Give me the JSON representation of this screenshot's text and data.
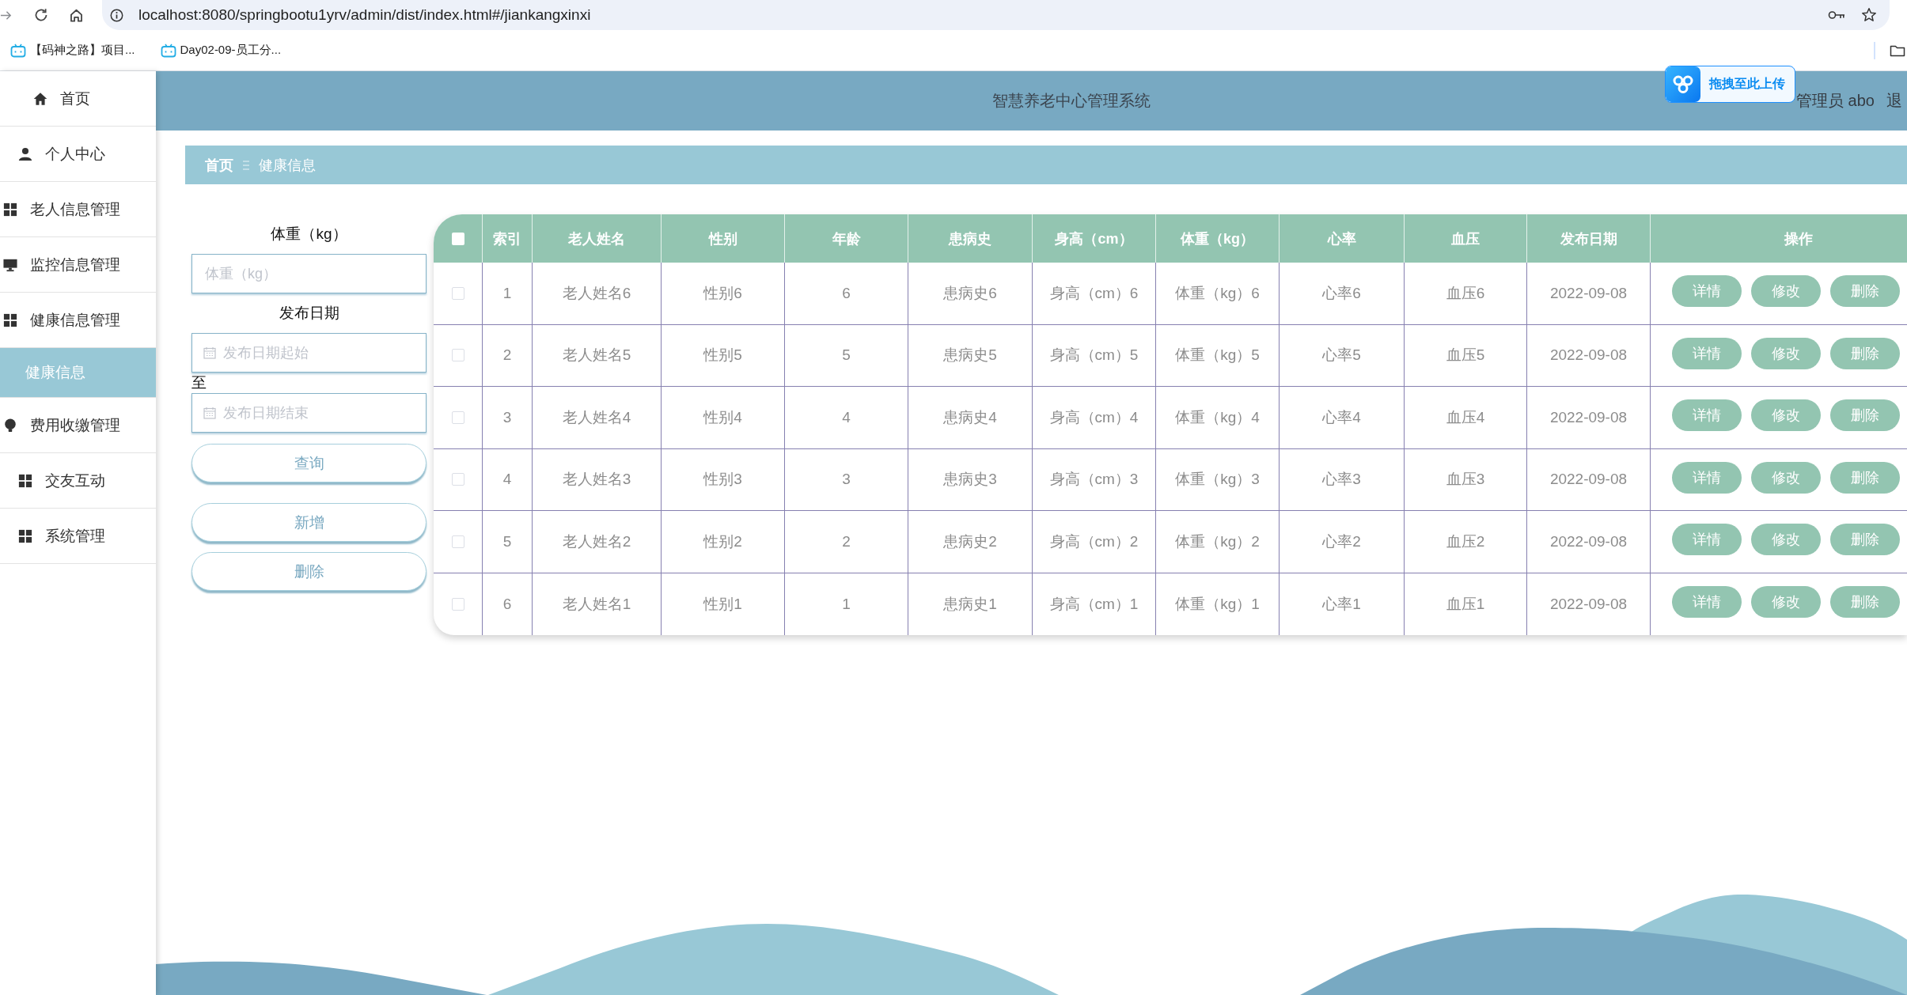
{
  "browser": {
    "url": "localhost:8080/springbootu1yrv/admin/dist/index.html#/jiankangxinxi",
    "bookmarks": [
      {
        "label": "【码神之路】项目..."
      },
      {
        "label": "Day02-09-员工分..."
      }
    ]
  },
  "upload_widget": {
    "label": "拖拽至此上传"
  },
  "sidebar": {
    "items": [
      {
        "label": "首页",
        "kind": "home",
        "selected": false
      },
      {
        "label": "个人中心",
        "kind": "person",
        "selected": false
      },
      {
        "label": "老人信息管理",
        "kind": "grid",
        "selected": false
      },
      {
        "label": "监控信息管理",
        "kind": "monitor",
        "selected": false
      },
      {
        "label": "健康信息管理",
        "kind": "grid",
        "selected": false,
        "expanded": true,
        "children": [
          {
            "label": "健康信息",
            "selected": true
          }
        ]
      },
      {
        "label": "费用收缴管理",
        "kind": "bulb",
        "selected": false
      },
      {
        "label": "交友互动",
        "kind": "grid",
        "selected": false
      },
      {
        "label": "系统管理",
        "kind": "grid",
        "selected": false
      }
    ]
  },
  "header": {
    "title": "智慧养老中心管理系统",
    "user": "管理员 abo",
    "logout": "退"
  },
  "breadcrumb": [
    {
      "label": "首页",
      "kind": "link"
    },
    {
      "label": "健康信息",
      "kind": "current"
    }
  ],
  "search": {
    "weight": {
      "label": "体重（kg）",
      "placeholder": "体重（kg）"
    },
    "date": {
      "label": "发布日期",
      "start": {
        "placeholder": "发布日期起始"
      },
      "separator": "至",
      "end": {
        "placeholder": "发布日期结束"
      }
    },
    "buttons": [
      "查询",
      "新增",
      "删除"
    ]
  },
  "table": {
    "select_all": {
      "checked": false
    },
    "columns": [
      "索引",
      "老人姓名",
      "性别",
      "年龄",
      "患病史",
      "身高（cm）",
      "体重（kg）",
      "心率",
      "血压",
      "发布日期",
      "操作"
    ],
    "rows": [
      {
        "checked": false,
        "cells": [
          "1",
          "老人姓名6",
          "性别6",
          "6",
          "患病史6",
          "身高（cm）6",
          "体重（kg）6",
          "心率6",
          "血压6",
          "2022-09-08"
        ],
        "actions": [
          "详情",
          "修改",
          "删除"
        ]
      },
      {
        "checked": false,
        "cells": [
          "2",
          "老人姓名5",
          "性别5",
          "5",
          "患病史5",
          "身高（cm）5",
          "体重（kg）5",
          "心率5",
          "血压5",
          "2022-09-08"
        ],
        "actions": [
          "详情",
          "修改",
          "删除"
        ]
      },
      {
        "checked": false,
        "cells": [
          "3",
          "老人姓名4",
          "性别4",
          "4",
          "患病史4",
          "身高（cm）4",
          "体重（kg）4",
          "心率4",
          "血压4",
          "2022-09-08"
        ],
        "actions": [
          "详情",
          "修改",
          "删除"
        ]
      },
      {
        "checked": false,
        "cells": [
          "4",
          "老人姓名3",
          "性别3",
          "3",
          "患病史3",
          "身高（cm）3",
          "体重（kg）3",
          "心率3",
          "血压3",
          "2022-09-08"
        ],
        "actions": [
          "详情",
          "修改",
          "删除"
        ]
      },
      {
        "checked": false,
        "cells": [
          "5",
          "老人姓名2",
          "性别2",
          "2",
          "患病史2",
          "身高（cm）2",
          "体重（kg）2",
          "心率2",
          "血压2",
          "2022-09-08"
        ],
        "actions": [
          "详情",
          "修改",
          "删除"
        ]
      },
      {
        "checked": false,
        "cells": [
          "6",
          "老人姓名1",
          "性别1",
          "1",
          "患病史1",
          "身高（cm）1",
          "体重（kg）1",
          "心率1",
          "血压1",
          "2022-09-08"
        ],
        "actions": [
          "详情",
          "修改",
          "删除"
        ]
      }
    ]
  }
}
